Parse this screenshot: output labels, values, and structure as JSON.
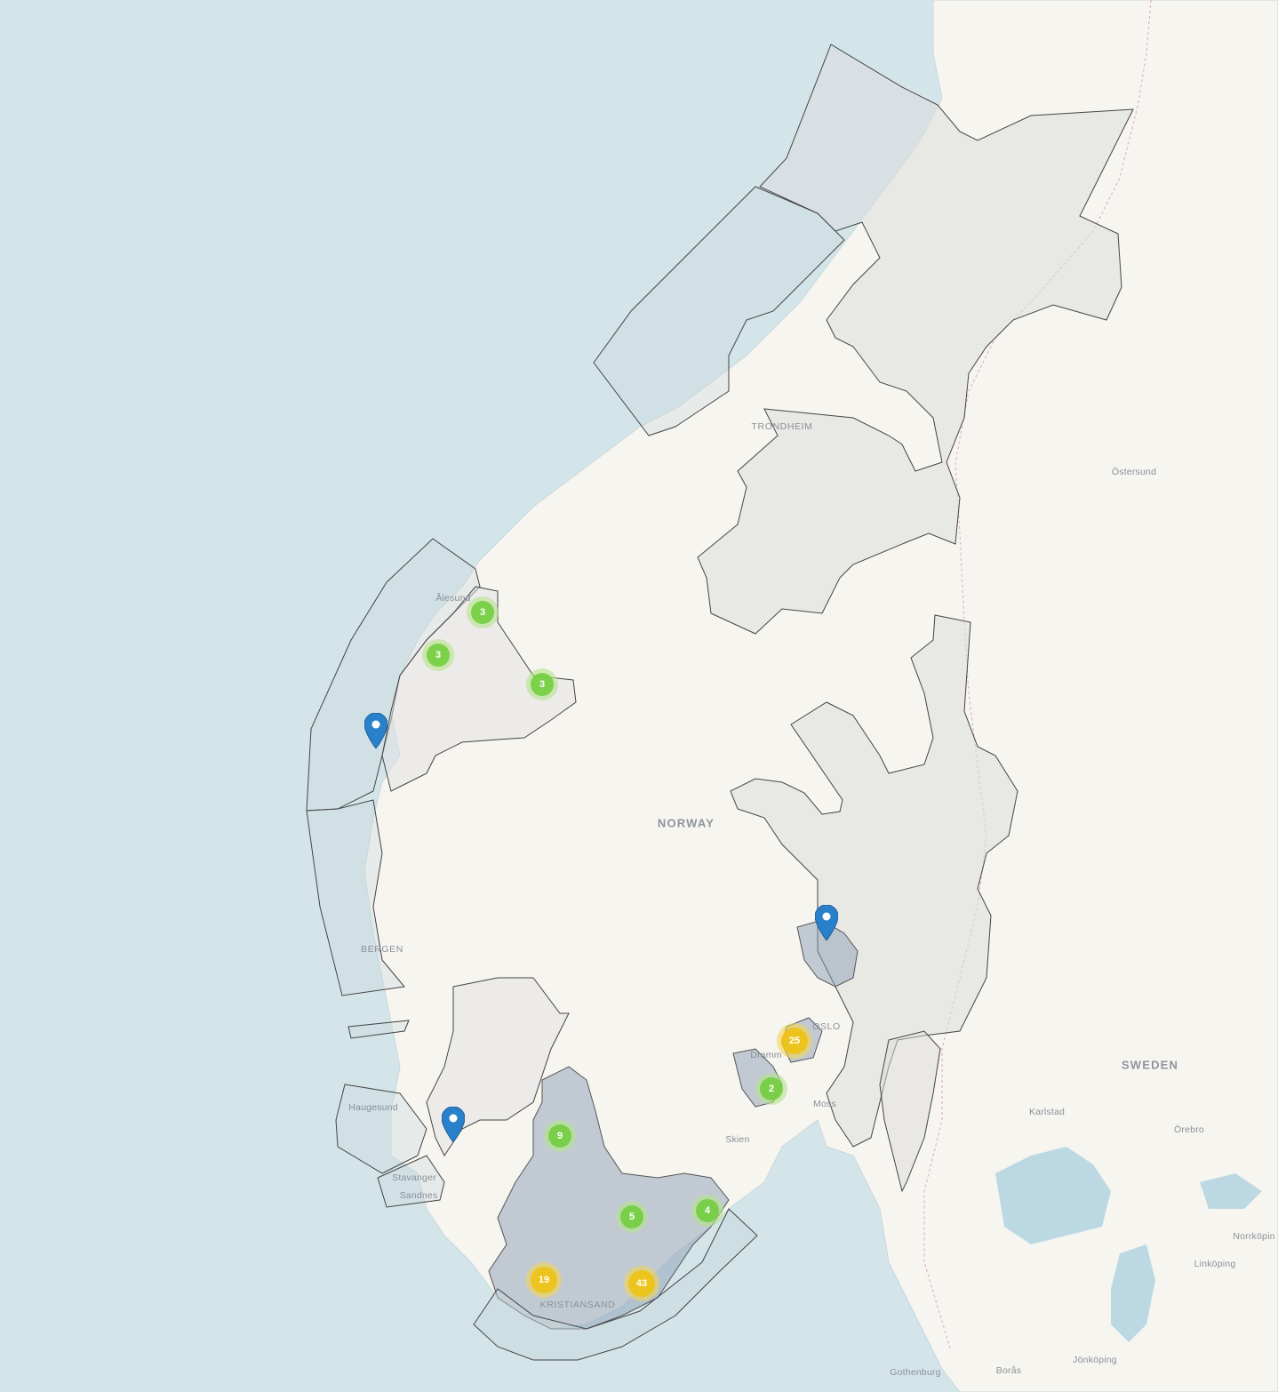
{
  "map": {
    "labels": {
      "countries": [
        {
          "id": "norway",
          "text": "NORWAY"
        },
        {
          "id": "sweden",
          "text": "SWEDEN"
        }
      ],
      "cities": [
        {
          "id": "trondheim",
          "text": "TRONDHEIM"
        },
        {
          "id": "oslo",
          "text": "OSLO"
        },
        {
          "id": "bergen",
          "text": "BERGEN"
        },
        {
          "id": "alesund",
          "text": "Ålesund"
        },
        {
          "id": "ostersund",
          "text": "Östersund"
        },
        {
          "id": "haugesund",
          "text": "Haugesund"
        },
        {
          "id": "stavanger",
          "text": "Stavanger"
        },
        {
          "id": "sandnes",
          "text": "Sandnes"
        },
        {
          "id": "kristiansand",
          "text": "KRISTIANSAND"
        },
        {
          "id": "skien",
          "text": "Skien"
        },
        {
          "id": "moss",
          "text": "Moss"
        },
        {
          "id": "drammen",
          "text": "Dramm"
        },
        {
          "id": "karlstad",
          "text": "Karlstad"
        },
        {
          "id": "orebro",
          "text": "Örebro"
        },
        {
          "id": "norrkoping",
          "text": "Norrköpin"
        },
        {
          "id": "linkoping",
          "text": "Linköping"
        },
        {
          "id": "jonkoping",
          "text": "Jönköping"
        },
        {
          "id": "boras",
          "text": "Borås"
        },
        {
          "id": "gothenburg",
          "text": "Gothenburg"
        }
      ]
    },
    "clusters": [
      {
        "id": "c1",
        "count": "3",
        "size": "small"
      },
      {
        "id": "c2",
        "count": "3",
        "size": "small"
      },
      {
        "id": "c3",
        "count": "3",
        "size": "small"
      },
      {
        "id": "c4",
        "count": "25",
        "size": "medium"
      },
      {
        "id": "c5",
        "count": "2",
        "size": "small"
      },
      {
        "id": "c6",
        "count": "9",
        "size": "small"
      },
      {
        "id": "c7",
        "count": "5",
        "size": "small"
      },
      {
        "id": "c8",
        "count": "4",
        "size": "small"
      },
      {
        "id": "c9",
        "count": "19",
        "size": "medium"
      },
      {
        "id": "c10",
        "count": "43",
        "size": "medium"
      }
    ],
    "markers": [
      {
        "id": "m1",
        "icon": "map-pin-icon"
      },
      {
        "id": "m2",
        "icon": "map-pin-icon"
      },
      {
        "id": "m3",
        "icon": "map-pin-icon"
      }
    ],
    "colors": {
      "sea": "#d4e5ea",
      "land": "#f6f5f0",
      "region_fill": "#e6e6e6",
      "region_dark": "#b3bcc6",
      "marker": "#2a81cb",
      "cluster_small": "#6ecc39",
      "cluster_medium": "#f0c20c"
    }
  }
}
